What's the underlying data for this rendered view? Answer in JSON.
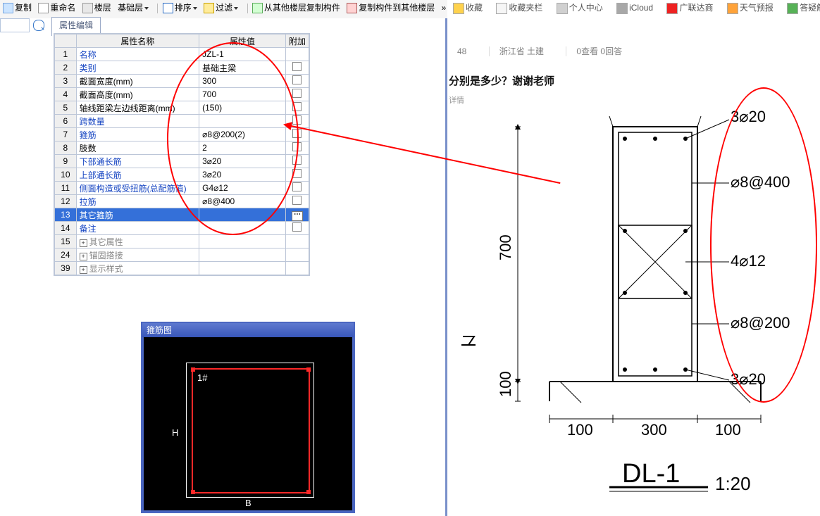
{
  "toolbar": {
    "copy": "复制",
    "rename": "重命名",
    "floor": "楼层",
    "basic_layer": "基础层",
    "sort": "排序",
    "filter": "过滤",
    "copy_from": "从其他楼层复制构件",
    "copy_to": "复制构件到其他楼层",
    "more": "»"
  },
  "tab": {
    "property_edit": "属性编辑"
  },
  "headers": {
    "name": "属性名称",
    "value": "属性值",
    "add": "附加"
  },
  "rows": [
    {
      "n": "1",
      "name": "名称",
      "cls": "blue",
      "val": "JZL-1"
    },
    {
      "n": "2",
      "name": "类别",
      "cls": "blue",
      "val": "基础主梁"
    },
    {
      "n": "3",
      "name": "截面宽度(mm)",
      "cls": "",
      "val": "300"
    },
    {
      "n": "4",
      "name": "截面高度(mm)",
      "cls": "",
      "val": "700"
    },
    {
      "n": "5",
      "name": "轴线距梁左边线距离(mm)",
      "cls": "",
      "val": "(150)"
    },
    {
      "n": "6",
      "name": "跨数量",
      "cls": "blue",
      "val": ""
    },
    {
      "n": "7",
      "name": "箍筋",
      "cls": "blue",
      "val": "⌀8@200(2)"
    },
    {
      "n": "8",
      "name": "肢数",
      "cls": "",
      "val": "2"
    },
    {
      "n": "9",
      "name": "下部通长筋",
      "cls": "blue",
      "val": "3⌀20"
    },
    {
      "n": "10",
      "name": "上部通长筋",
      "cls": "blue",
      "val": "3⌀20"
    },
    {
      "n": "11",
      "name": "侧面构造或受扭筋(总配筋值)",
      "cls": "blue",
      "val": "G4⌀12"
    },
    {
      "n": "12",
      "name": "拉筋",
      "cls": "blue",
      "val": "⌀8@400"
    },
    {
      "n": "13",
      "name": "其它箍筋",
      "cls": "sel",
      "val": ""
    },
    {
      "n": "14",
      "name": "备注",
      "cls": "blue",
      "val": ""
    },
    {
      "n": "15",
      "name": "其它属性",
      "cls": "gray",
      "val": "",
      "expand": true
    },
    {
      "n": "24",
      "name": "锚固搭接",
      "cls": "gray",
      "val": "",
      "expand": true
    },
    {
      "n": "39",
      "name": "显示样式",
      "cls": "gray",
      "val": "",
      "expand": true
    }
  ],
  "stirrup": {
    "title": "箍筋图",
    "label": "1#",
    "axisH": "H",
    "axisB": "B"
  },
  "browser": {
    "fav": "收藏",
    "favfolder": "收藏夹栏",
    "user": "个人中心",
    "icloud": "iCloud",
    "glodon": "广联达商",
    "weather": "天气预报",
    "faq": "答疑解惑"
  },
  "meta": {
    "code": "48",
    "region": "浙江省 土建",
    "views": "0查看 0回答"
  },
  "question_text": "分别是多少？谢谢老师",
  "detail_text": "详情",
  "diagram": {
    "top_bar": "3⌀20",
    "tie": "⌀8@400",
    "side": "4⌀12",
    "stirrup": "⌀8@200",
    "bot_bar": "3⌀20",
    "h": "700",
    "h2": "100",
    "w_l": "100",
    "w_m": "300",
    "w_r": "100",
    "name": "DL-1",
    "scale": "1:20"
  }
}
